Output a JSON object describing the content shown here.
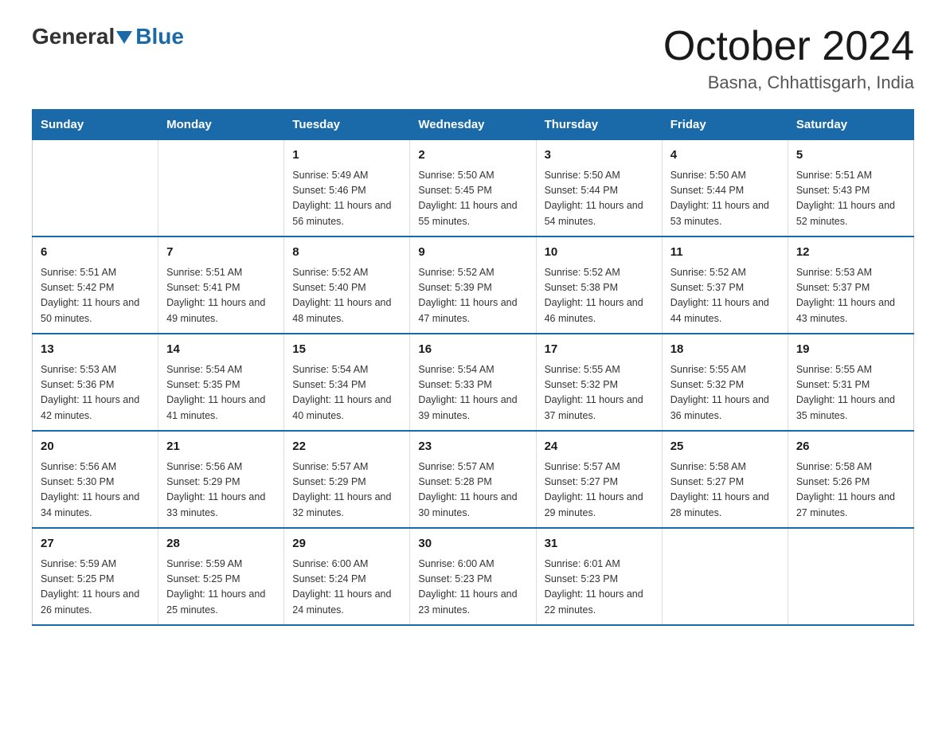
{
  "header": {
    "logo_general": "General",
    "logo_blue": "Blue",
    "month_title": "October 2024",
    "location": "Basna, Chhattisgarh, India"
  },
  "days_of_week": [
    "Sunday",
    "Monday",
    "Tuesday",
    "Wednesday",
    "Thursday",
    "Friday",
    "Saturday"
  ],
  "weeks": [
    [
      {
        "day": "",
        "info": ""
      },
      {
        "day": "",
        "info": ""
      },
      {
        "day": "1",
        "info": "Sunrise: 5:49 AM\nSunset: 5:46 PM\nDaylight: 11 hours\nand 56 minutes."
      },
      {
        "day": "2",
        "info": "Sunrise: 5:50 AM\nSunset: 5:45 PM\nDaylight: 11 hours\nand 55 minutes."
      },
      {
        "day": "3",
        "info": "Sunrise: 5:50 AM\nSunset: 5:44 PM\nDaylight: 11 hours\nand 54 minutes."
      },
      {
        "day": "4",
        "info": "Sunrise: 5:50 AM\nSunset: 5:44 PM\nDaylight: 11 hours\nand 53 minutes."
      },
      {
        "day": "5",
        "info": "Sunrise: 5:51 AM\nSunset: 5:43 PM\nDaylight: 11 hours\nand 52 minutes."
      }
    ],
    [
      {
        "day": "6",
        "info": "Sunrise: 5:51 AM\nSunset: 5:42 PM\nDaylight: 11 hours\nand 50 minutes."
      },
      {
        "day": "7",
        "info": "Sunrise: 5:51 AM\nSunset: 5:41 PM\nDaylight: 11 hours\nand 49 minutes."
      },
      {
        "day": "8",
        "info": "Sunrise: 5:52 AM\nSunset: 5:40 PM\nDaylight: 11 hours\nand 48 minutes."
      },
      {
        "day": "9",
        "info": "Sunrise: 5:52 AM\nSunset: 5:39 PM\nDaylight: 11 hours\nand 47 minutes."
      },
      {
        "day": "10",
        "info": "Sunrise: 5:52 AM\nSunset: 5:38 PM\nDaylight: 11 hours\nand 46 minutes."
      },
      {
        "day": "11",
        "info": "Sunrise: 5:52 AM\nSunset: 5:37 PM\nDaylight: 11 hours\nand 44 minutes."
      },
      {
        "day": "12",
        "info": "Sunrise: 5:53 AM\nSunset: 5:37 PM\nDaylight: 11 hours\nand 43 minutes."
      }
    ],
    [
      {
        "day": "13",
        "info": "Sunrise: 5:53 AM\nSunset: 5:36 PM\nDaylight: 11 hours\nand 42 minutes."
      },
      {
        "day": "14",
        "info": "Sunrise: 5:54 AM\nSunset: 5:35 PM\nDaylight: 11 hours\nand 41 minutes."
      },
      {
        "day": "15",
        "info": "Sunrise: 5:54 AM\nSunset: 5:34 PM\nDaylight: 11 hours\nand 40 minutes."
      },
      {
        "day": "16",
        "info": "Sunrise: 5:54 AM\nSunset: 5:33 PM\nDaylight: 11 hours\nand 39 minutes."
      },
      {
        "day": "17",
        "info": "Sunrise: 5:55 AM\nSunset: 5:32 PM\nDaylight: 11 hours\nand 37 minutes."
      },
      {
        "day": "18",
        "info": "Sunrise: 5:55 AM\nSunset: 5:32 PM\nDaylight: 11 hours\nand 36 minutes."
      },
      {
        "day": "19",
        "info": "Sunrise: 5:55 AM\nSunset: 5:31 PM\nDaylight: 11 hours\nand 35 minutes."
      }
    ],
    [
      {
        "day": "20",
        "info": "Sunrise: 5:56 AM\nSunset: 5:30 PM\nDaylight: 11 hours\nand 34 minutes."
      },
      {
        "day": "21",
        "info": "Sunrise: 5:56 AM\nSunset: 5:29 PM\nDaylight: 11 hours\nand 33 minutes."
      },
      {
        "day": "22",
        "info": "Sunrise: 5:57 AM\nSunset: 5:29 PM\nDaylight: 11 hours\nand 32 minutes."
      },
      {
        "day": "23",
        "info": "Sunrise: 5:57 AM\nSunset: 5:28 PM\nDaylight: 11 hours\nand 30 minutes."
      },
      {
        "day": "24",
        "info": "Sunrise: 5:57 AM\nSunset: 5:27 PM\nDaylight: 11 hours\nand 29 minutes."
      },
      {
        "day": "25",
        "info": "Sunrise: 5:58 AM\nSunset: 5:27 PM\nDaylight: 11 hours\nand 28 minutes."
      },
      {
        "day": "26",
        "info": "Sunrise: 5:58 AM\nSunset: 5:26 PM\nDaylight: 11 hours\nand 27 minutes."
      }
    ],
    [
      {
        "day": "27",
        "info": "Sunrise: 5:59 AM\nSunset: 5:25 PM\nDaylight: 11 hours\nand 26 minutes."
      },
      {
        "day": "28",
        "info": "Sunrise: 5:59 AM\nSunset: 5:25 PM\nDaylight: 11 hours\nand 25 minutes."
      },
      {
        "day": "29",
        "info": "Sunrise: 6:00 AM\nSunset: 5:24 PM\nDaylight: 11 hours\nand 24 minutes."
      },
      {
        "day": "30",
        "info": "Sunrise: 6:00 AM\nSunset: 5:23 PM\nDaylight: 11 hours\nand 23 minutes."
      },
      {
        "day": "31",
        "info": "Sunrise: 6:01 AM\nSunset: 5:23 PM\nDaylight: 11 hours\nand 22 minutes."
      },
      {
        "day": "",
        "info": ""
      },
      {
        "day": "",
        "info": ""
      }
    ]
  ]
}
